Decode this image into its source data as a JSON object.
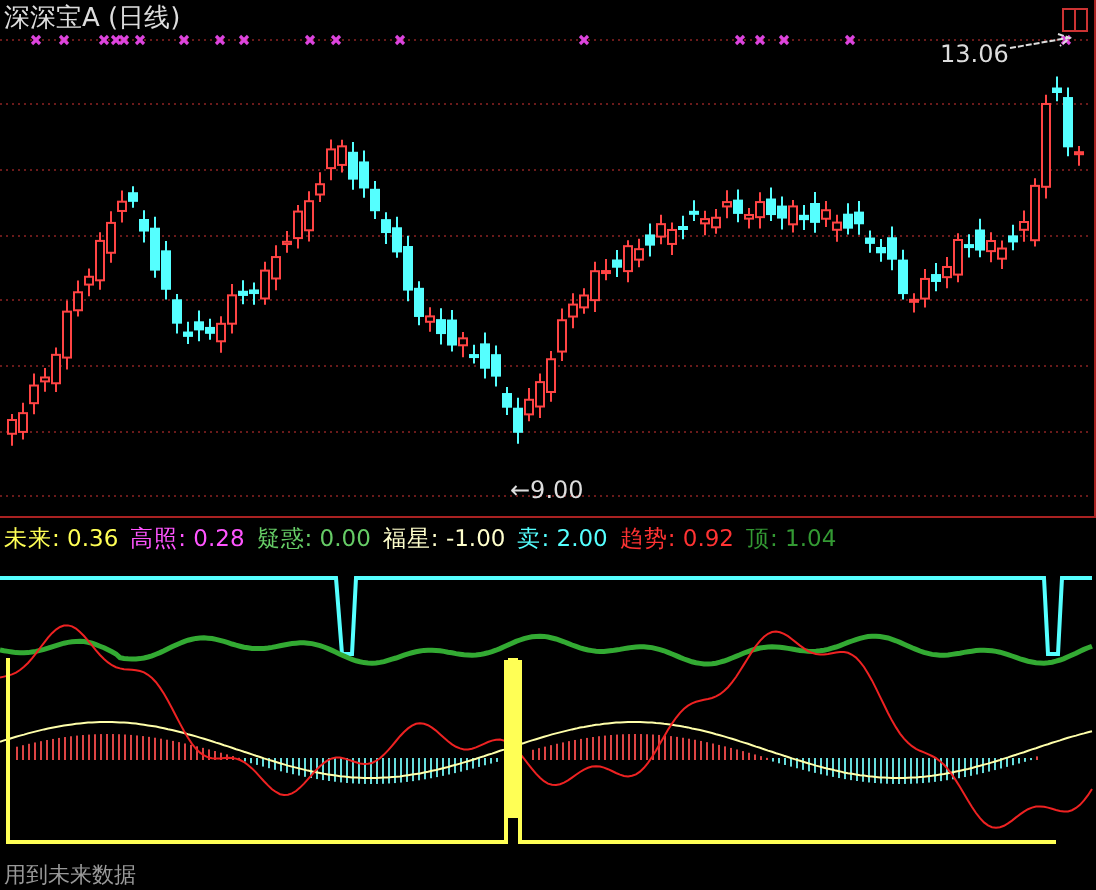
{
  "window": {
    "title": "深深宝A (日线)"
  },
  "price_chart": {
    "high_label": "13.06",
    "low_label": "←9.00"
  },
  "indicator": {
    "legend": [
      {
        "label": "未来:",
        "value": "0.36",
        "color": "#ffff55"
      },
      {
        "label": "高照:",
        "value": "0.28",
        "color": "#ff55ff"
      },
      {
        "label": "疑惑:",
        "value": "0.00",
        "color": "#66cc66"
      },
      {
        "label": "福星:",
        "value": "-1.00",
        "color": "#ffffcc"
      },
      {
        "label": "卖:",
        "value": "2.00",
        "color": "#55ffff"
      },
      {
        "label": "趋势:",
        "value": "0.92",
        "color": "#ff3333"
      },
      {
        "label": "顶:",
        "value": "1.04",
        "color": "#339933"
      }
    ]
  },
  "status_bar": {
    "text": "用到未来数据"
  }
}
